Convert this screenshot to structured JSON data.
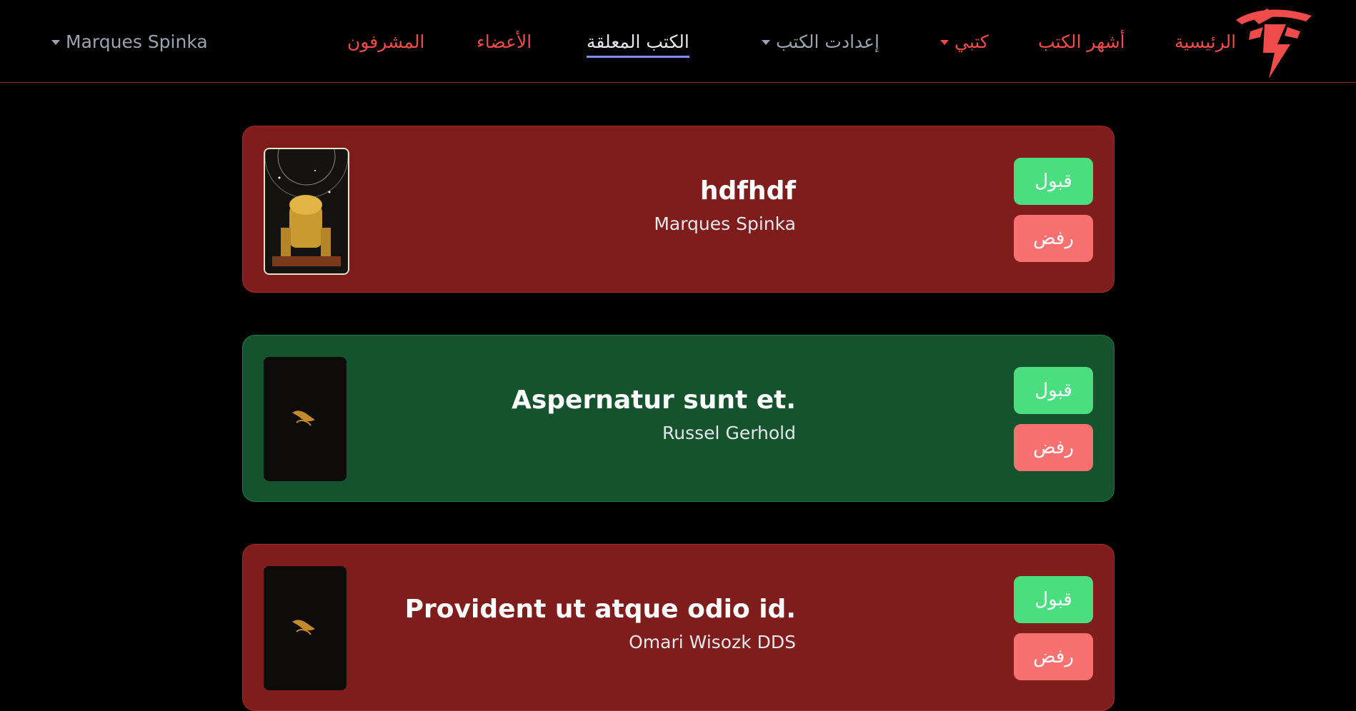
{
  "nav": {
    "home": "الرئيسية",
    "popular": "أشهر الكتب",
    "my_books": "كتبي",
    "book_settings": "إعدادت الكتب",
    "pending": "الكتب المعلقة",
    "members": "الأعضاء",
    "supervisors": "المشرفون",
    "user": "Marques Spinka"
  },
  "books": [
    {
      "title": "hdfhdf",
      "author": "Marques Spinka",
      "accept": "قبول",
      "reject": "رفض"
    },
    {
      "title": "Aspernatur sunt et.",
      "author": "Russel Gerhold",
      "accept": "قبول",
      "reject": "رفض"
    },
    {
      "title": "Provident ut atque odio id.",
      "author": "Omari Wisozk DDS",
      "accept": "قبول",
      "reject": "رفض"
    }
  ],
  "colors": {
    "background": "#000000",
    "card_red": "#7f1d1d",
    "card_green": "#14532d",
    "accept": "#4ade80",
    "reject": "#f87171",
    "nav_accent": "#ef4b4b"
  },
  "icons": {
    "logo": "winged-lightning-logo",
    "dropdown": "caret-down-icon"
  }
}
